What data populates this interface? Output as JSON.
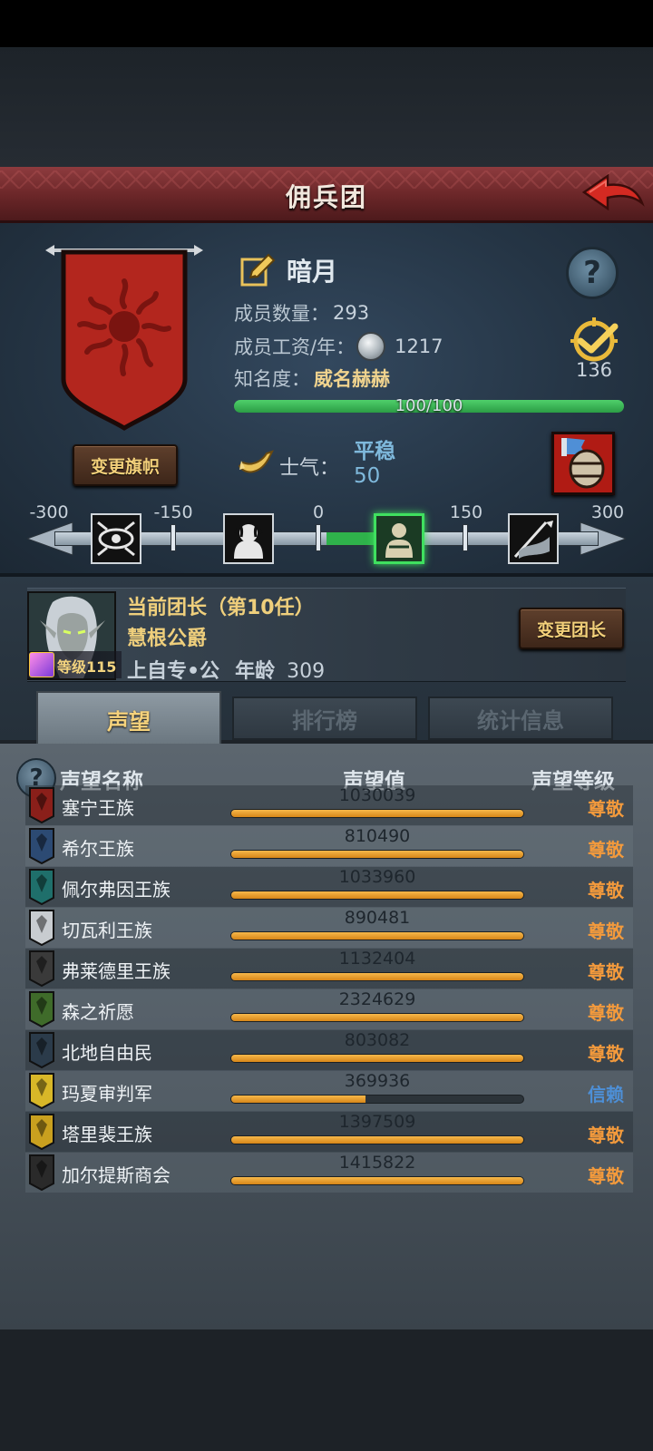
{
  "header": {
    "title": "佣兵团"
  },
  "company": {
    "name": "暗月",
    "member_count_label": "成员数量：",
    "member_count": "293",
    "salary_label": "成员工资/年：",
    "salary": "1217",
    "fame_label": "知名度：",
    "fame_value": "威名赫赫",
    "fame_progress_text": "100/100",
    "fame_progress": 1.0,
    "task_count": "136",
    "change_banner_label": "变更旗帜",
    "banner_color": "#b3261e"
  },
  "morale": {
    "label": "士气：",
    "state": "平稳",
    "value": "50",
    "scale_labels": [
      "-300",
      "-150",
      "0",
      "150",
      "300"
    ],
    "stage_icons": [
      "mad-eye-icon",
      "despair-icon",
      "calm-figure-icon",
      "charging-banner-icon"
    ],
    "active_stage": 2
  },
  "leader": {
    "title": "当前团长（第10任）",
    "name": "慧根公爵",
    "level_text": "等级115",
    "traits": "上自专•公",
    "age_label": "年龄",
    "age": "309",
    "change_leader_label": "变更团长"
  },
  "tabs": [
    {
      "label": "声望",
      "active": true
    },
    {
      "label": "排行榜",
      "active": false
    },
    {
      "label": "统计信息",
      "active": false
    }
  ],
  "reputation": {
    "headers": {
      "name": "声望名称",
      "value": "声望值",
      "level": "声望等级"
    },
    "rows": [
      {
        "name": "塞宁王族",
        "value": "1030039",
        "progress": 1.0,
        "level": "尊敬",
        "level_color": "#f39a3c",
        "emblem_color": "#8a1f1a"
      },
      {
        "name": "希尔王族",
        "value": "810490",
        "progress": 1.0,
        "level": "尊敬",
        "level_color": "#f39a3c",
        "emblem_color": "#2c4a73"
      },
      {
        "name": "佩尔弗因王族",
        "value": "1033960",
        "progress": 1.0,
        "level": "尊敬",
        "level_color": "#f39a3c",
        "emblem_color": "#1f6f6b"
      },
      {
        "name": "切瓦利王族",
        "value": "890481",
        "progress": 1.0,
        "level": "尊敬",
        "level_color": "#f39a3c",
        "emblem_color": "#c8ccd0"
      },
      {
        "name": "弗莱德里王族",
        "value": "1132404",
        "progress": 1.0,
        "level": "尊敬",
        "level_color": "#f39a3c",
        "emblem_color": "#3a3a3a"
      },
      {
        "name": "森之祈愿",
        "value": "2324629",
        "progress": 1.0,
        "level": "尊敬",
        "level_color": "#f39a3c",
        "emblem_color": "#3f6b2a"
      },
      {
        "name": "北地自由民",
        "value": "803082",
        "progress": 1.0,
        "level": "尊敬",
        "level_color": "#f39a3c",
        "emblem_color": "#2b3b4a"
      },
      {
        "name": "玛夏审判军",
        "value": "369936",
        "progress": 0.46,
        "level": "信赖",
        "level_color": "#4d8fd6",
        "emblem_color": "#d8b728"
      },
      {
        "name": "塔里裴王族",
        "value": "1397509",
        "progress": 1.0,
        "level": "尊敬",
        "level_color": "#f39a3c",
        "emblem_color": "#c9a01f"
      },
      {
        "name": "加尔提斯商会",
        "value": "1415822",
        "progress": 1.0,
        "level": "尊敬",
        "level_color": "#f39a3c",
        "emblem_color": "#2a2a2a"
      }
    ]
  }
}
